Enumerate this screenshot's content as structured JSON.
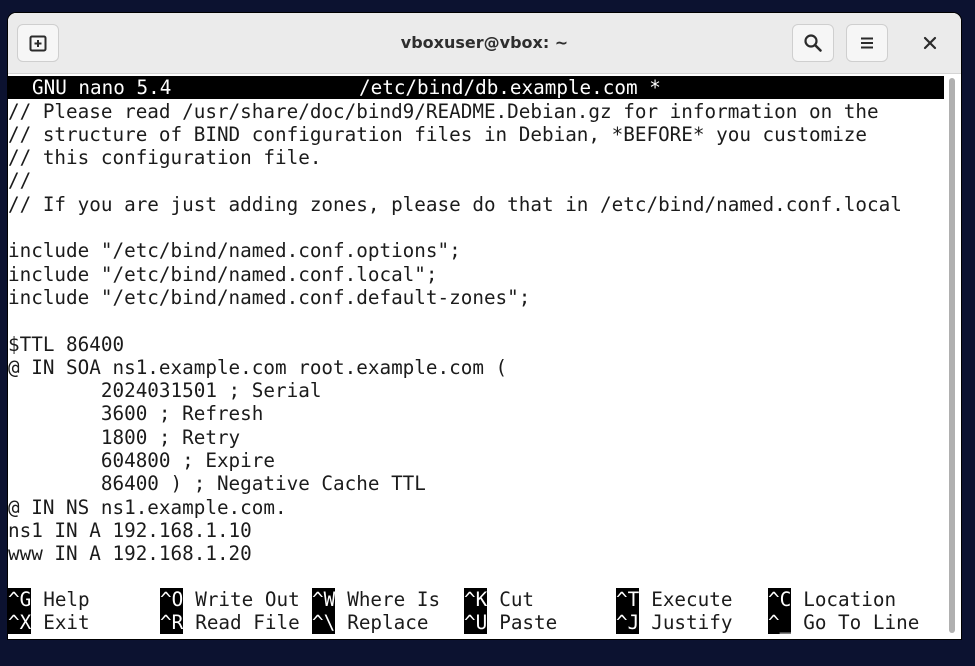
{
  "window": {
    "title": "vboxuser@vbox: ~"
  },
  "icons": {
    "new_tab": "new-tab-icon",
    "search": "search-icon",
    "menu": "hamburger-menu-icon",
    "close": "close-icon"
  },
  "nano": {
    "version": "GNU nano 5.4",
    "filename": "/etc/bind/db.example.com *"
  },
  "buffer": {
    "lines": [
      "// Please read /usr/share/doc/bind9/README.Debian.gz for information on the",
      "// structure of BIND configuration files in Debian, *BEFORE* you customize",
      "// this configuration file.",
      "//",
      "// If you are just adding zones, please do that in /etc/bind/named.conf.local",
      "",
      "include \"/etc/bind/named.conf.options\";",
      "include \"/etc/bind/named.conf.local\";",
      "include \"/etc/bind/named.conf.default-zones\";",
      "",
      "$TTL 86400",
      "@ IN SOA ns1.example.com root.example.com (",
      "        2024031501 ; Serial",
      "        3600 ; Refresh",
      "        1800 ; Retry",
      "        604800 ; Expire",
      "        86400 ) ; Negative Cache TTL",
      "@ IN NS ns1.example.com.",
      "ns1 IN A 192.168.1.10",
      "www IN A 192.168.1.20"
    ]
  },
  "shortcuts": {
    "row1": [
      {
        "key": "^G",
        "label": "Help"
      },
      {
        "key": "^O",
        "label": "Write Out"
      },
      {
        "key": "^W",
        "label": "Where Is"
      },
      {
        "key": "^K",
        "label": "Cut"
      },
      {
        "key": "^T",
        "label": "Execute"
      },
      {
        "key": "^C",
        "label": "Location"
      }
    ],
    "row2": [
      {
        "key": "^X",
        "label": "Exit"
      },
      {
        "key": "^R",
        "label": "Read File"
      },
      {
        "key": "^\\",
        "label": "Replace"
      },
      {
        "key": "^U",
        "label": "Paste"
      },
      {
        "key": "^J",
        "label": "Justify"
      },
      {
        "key": "^_",
        "label": "Go To Line"
      }
    ]
  },
  "colors": {
    "titlebar_bg": "#ebebeb",
    "terminal_bg": "#ffffff",
    "terminal_fg": "#1b1b1b",
    "header_bg": "#000000",
    "desktop_bg": "#0c1230"
  }
}
